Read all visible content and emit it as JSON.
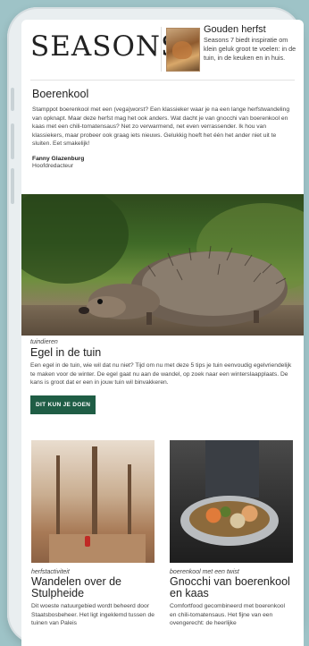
{
  "header": {
    "logo": "SEASONS",
    "promo": {
      "title": "Gouden herfst",
      "text": "Seasons 7 biedt inspiratie om klein geluk groot te voelen: in de tuin, in de keuken en in huis."
    }
  },
  "intro": {
    "title": "Boerenkool",
    "body": "Stamppot boerenkool met een (vega)worst? Een klassieker waar je na een lange herfstwandeling van opknapt. Maar deze herfst mag het ook anders. Wat dacht je van gnocchi van boerenkool en kaas met een chili-tomatensaus? Net zo verwarmend, net even verrassender. Ik hou van klassiekers, maar probeer ook graag iets nieuws. Gelukkig hoeft het één het ander niet uit te sluiten. Eet smakelijk!",
    "signature_name": "Fanny Glazenburg",
    "signature_role": "Hoofdredacteur"
  },
  "feature": {
    "kicker": "tuindieren",
    "title": "Egel in de tuin",
    "body": "Een egel in de tuin, wie wil dat nu niet? Tijd om nu met deze 5 tips je tuin eenvoudig egelvriendelijk te maken voor de winter. De egel gaat nu aan de wandel, op zoek naar een winterslaapplaats. De kans is groot dat er een in jouw tuin wil binvakkeren.",
    "cta": "DIT KUN JE DOEN"
  },
  "cards": [
    {
      "kicker": "herfstactiviteit",
      "title": "Wandelen over de Stulpheide",
      "body": "Dit woeste natuurgebied wordt beheerd door Staatsbosbeheer. Het ligt ingeklemd tussen de tuinen van Paleis"
    },
    {
      "kicker": "boerenkool met een twist",
      "title": "Gnocchi van boerenkool en kaas",
      "body": "Comfortfood gecombineerd met boerenkool en chili-tomatensaus. Het fijne van een ovengerecht: de heerlijke"
    }
  ],
  "colors": {
    "cta_bg": "#1f5d45",
    "page_bg": "#9ec3c7"
  }
}
